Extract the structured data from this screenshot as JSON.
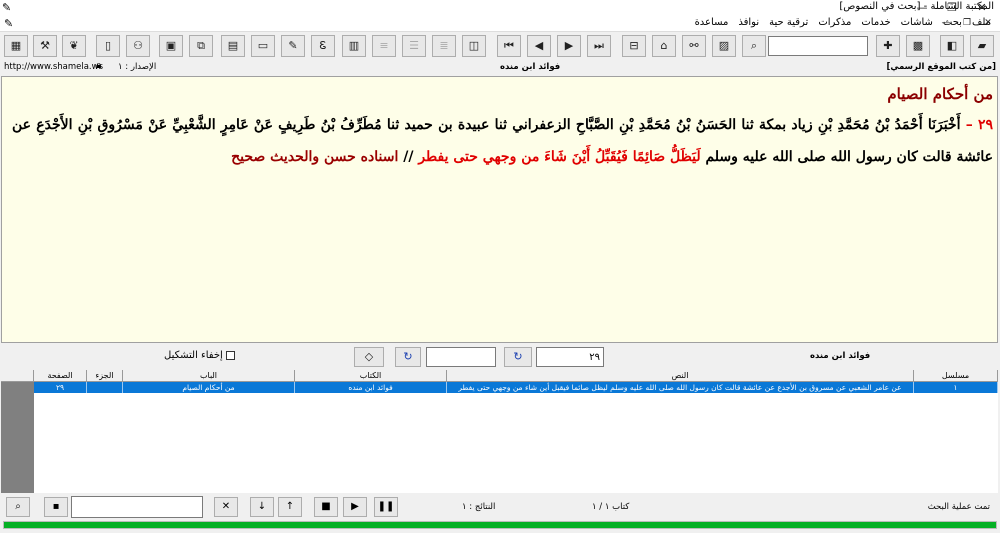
{
  "window": {
    "title": "المكتبة الشاملة - [بحث في النصوص]",
    "controls": {
      "minimize": "—",
      "restore": "❐",
      "close": "✕"
    }
  },
  "menu": {
    "items": [
      "ملف",
      "بحث",
      "شاشات",
      "خدمات",
      "مذكرات",
      "ترقية حية",
      "نوافذ",
      "مساعدة"
    ]
  },
  "toolbar": {
    "search_value": "",
    "extra_value": ""
  },
  "infobar": {
    "url": "http://www.shamela.ws",
    "edition_label": "الإصدار : ١",
    "book_name": "فوائد ابن منده",
    "site_label": "[من كتب الموقع الرسمي]"
  },
  "content": {
    "heading": "من أحكام الصيام",
    "number": "٢٩ –",
    "chain": "أَخْبَرَنَا أَحْمَدُ بْنُ مُحَمَّدِ بْنِ زياد بمكة ثنا الحَسَنُ بْنُ مُحَمَّدِ بْنِ الصَّبَّاحِ الزعفراني ثنا عبيدة بن حميد ثنا مُطَرِّفُ بْنُ طَرِيفٍ عَنْ عَامِرٍ الشَّعْبِيِّ عَنْ مَسْرُوقِ بْنِ الأَجْدَعِ عن عائشة قالت كان رسول الله صلى الله عليه وسلم",
    "hadith": "لَيَظَلُّ صَائِمًا فَيُقَبِّلُ أَيْنَ شَاءَ من وجهي حتى يفطر",
    "separator": "//",
    "grading": "اسناده حسن والحديث صحيح"
  },
  "midbar": {
    "book_name": "فوائد ابن منده",
    "number_value": "٢٩",
    "second_value": "",
    "hide_diacritics_label": "إخفاء التشكيل"
  },
  "results": {
    "columns": [
      "مسلسل",
      "النص",
      "الكتاب",
      "الباب",
      "الجزء",
      "الصفحة"
    ],
    "rows": [
      {
        "serial": "١",
        "text": "عن عامر الشعبي عن مسروق بن الأجدع عن عائشة قالت كان رسول الله صلى الله عليه وسلم ليظل صائما فيقبل أين شاء من وجهي حتى يفطر",
        "book": "فوائد ابن منده",
        "chapter": "من أحكام الصيام",
        "part": "",
        "page": "٢٩"
      }
    ]
  },
  "bottombar": {
    "status": "تمت عملية البحث",
    "book_counter": "كتاب ١ / ١",
    "results_label": "النتائج : ١",
    "filter_value": ""
  },
  "colors": {
    "progress": "#06b025",
    "selection": "#0a78d7",
    "content_bg": "#fefee8",
    "heading": "#8b0000",
    "hadith": "#e00000"
  }
}
